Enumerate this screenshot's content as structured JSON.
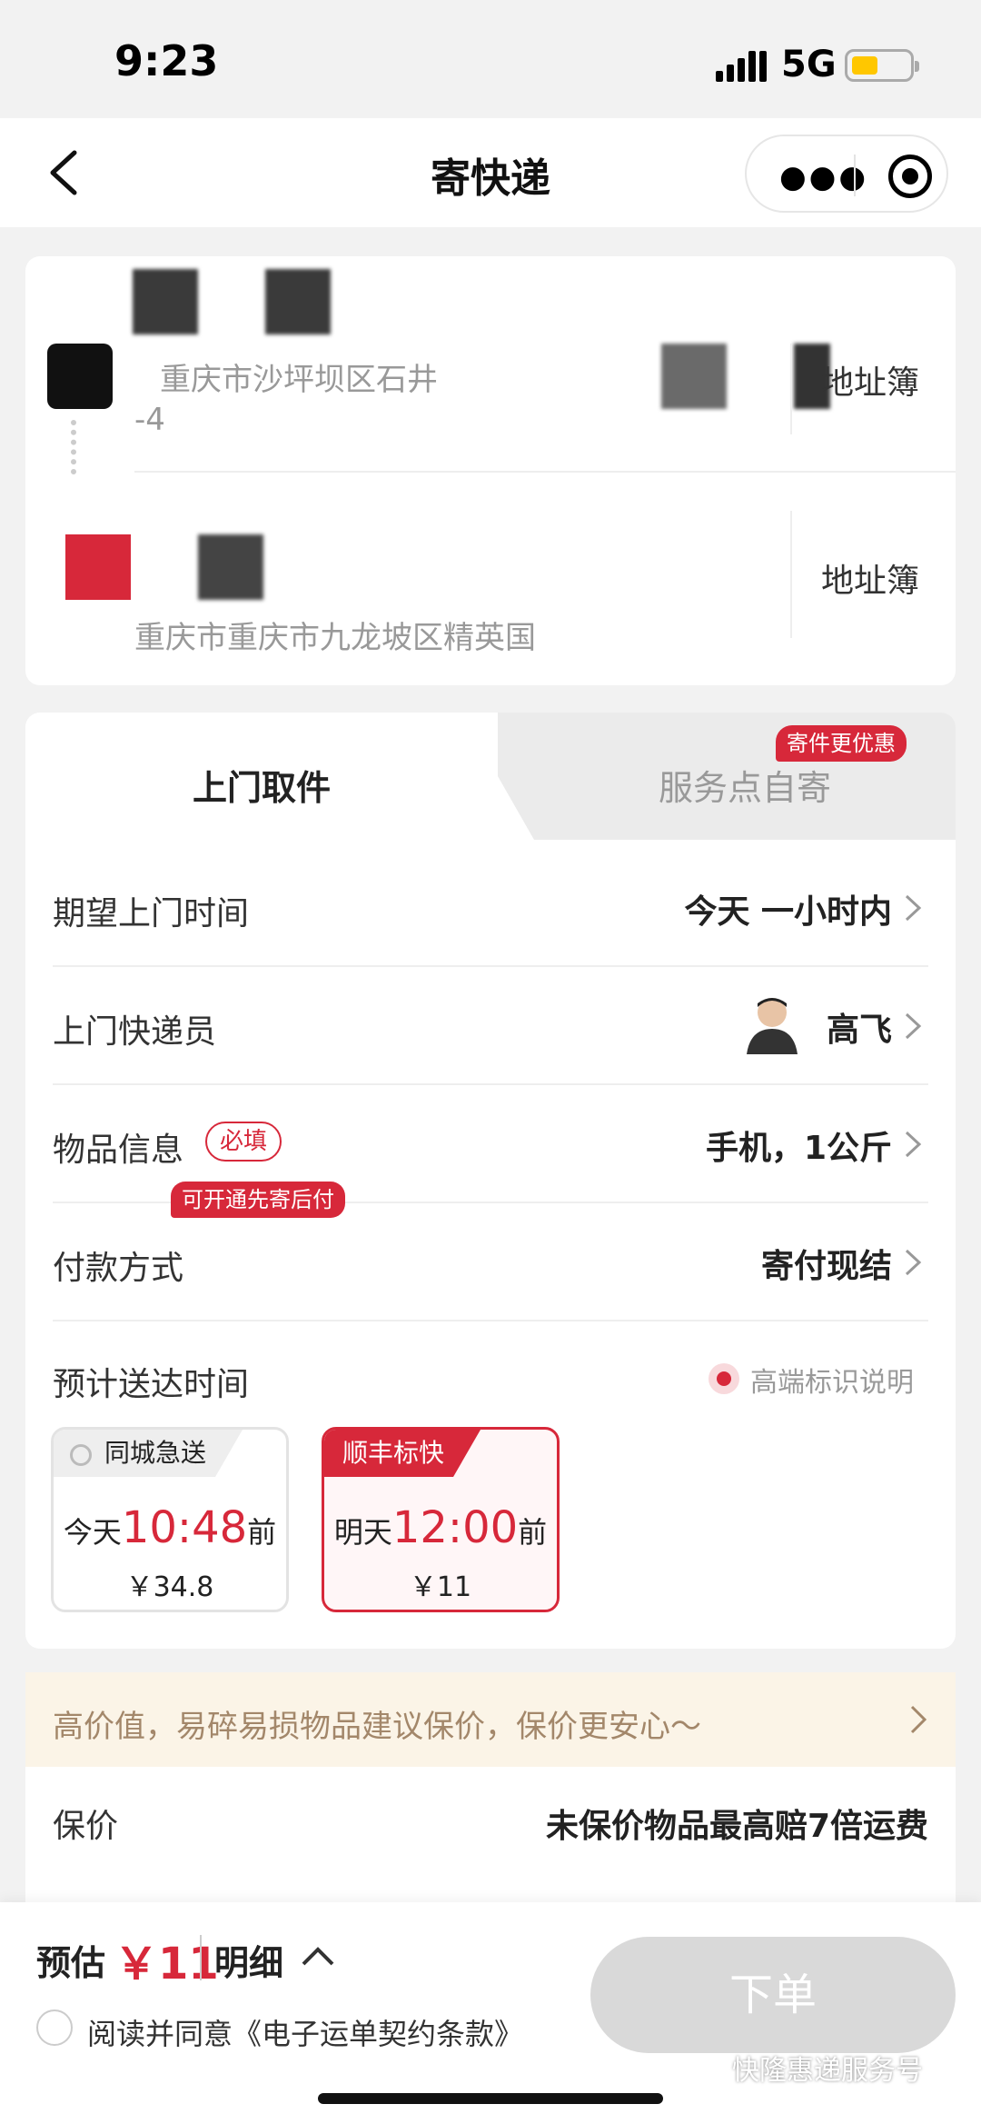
{
  "status_bar": {
    "time": "9:23",
    "network": "5G"
  },
  "nav": {
    "title": "寄快递"
  },
  "sender": {
    "address": "重庆市沙坪坝区石井",
    "detail": "-4",
    "address_book": "地址簿"
  },
  "receiver": {
    "address": "重庆市重庆市九龙坡区精英国",
    "address_book": "地址簿"
  },
  "tabs": [
    {
      "label": "上门取件",
      "active": true
    },
    {
      "label": "服务点自寄",
      "active": false,
      "badge": "寄件更优惠"
    }
  ],
  "rows": {
    "pickup_time": {
      "label": "期望上门时间",
      "value": "今天 一小时内"
    },
    "courier": {
      "label": "上门快递员",
      "value": "高飞"
    },
    "item_info": {
      "label": "物品信息",
      "required_tag": "必填",
      "value": "手机，1公斤"
    },
    "payment": {
      "label": "付款方式",
      "badge": "可开通先寄后付",
      "value": "寄付现结"
    }
  },
  "eta": {
    "label": "预计送达时间",
    "premium_note": "高端标识说明",
    "options": [
      {
        "tag": "同城急送",
        "day": "今天",
        "time": "10:48",
        "suffix": "前",
        "price": "￥34.8",
        "selected": false
      },
      {
        "tag": "顺丰标快",
        "day": "明天",
        "time": "12:00",
        "suffix": "前",
        "price": "￥11",
        "selected": true
      }
    ]
  },
  "insurance": {
    "banner": "高价值，易碎易损物品建议保价，保价更安心～",
    "label": "保价",
    "value": "未保价物品最高赔7倍运费"
  },
  "bottom": {
    "estimate_label": "预估",
    "estimate_price": "￥11",
    "detail_label": "明细",
    "agreement": "阅读并同意《电子运单契约条款》",
    "submit_label": "下单",
    "watermark": "快隆惠递服务号"
  },
  "colors": {
    "accent": "#d7283a",
    "background": "#f2f2f2",
    "battery": "#ffc700"
  }
}
